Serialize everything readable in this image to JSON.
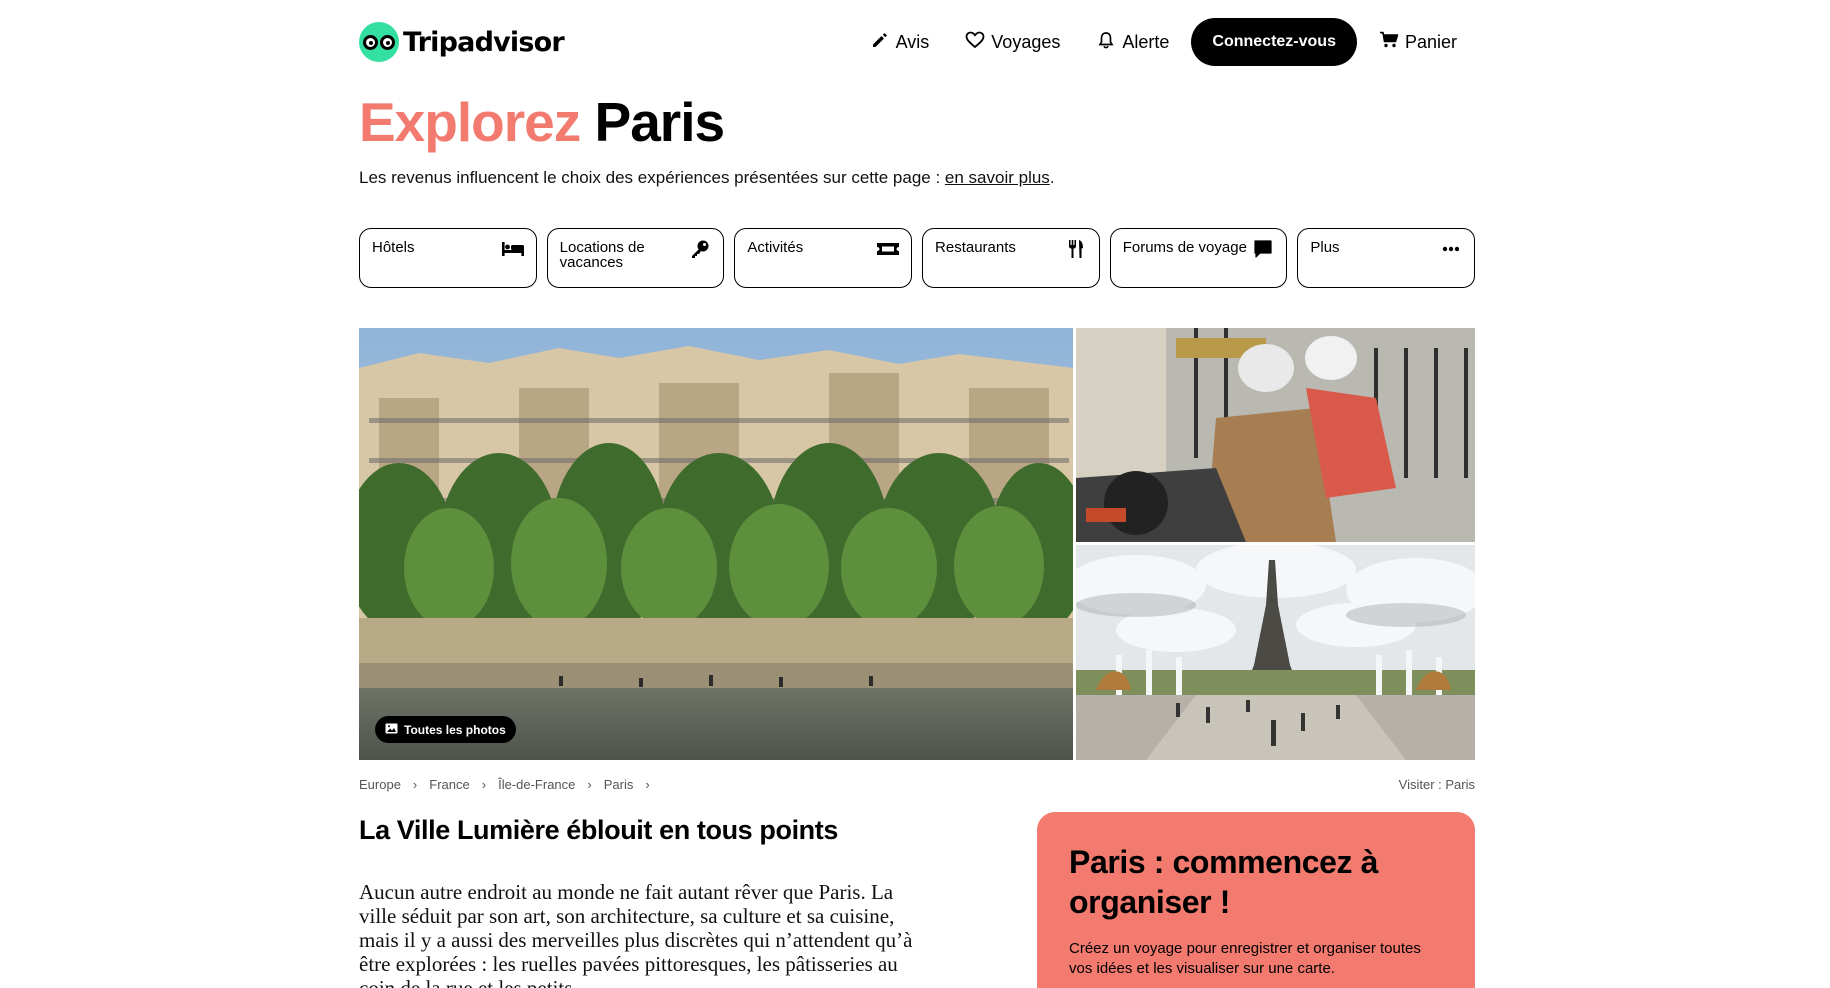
{
  "brand": {
    "name": "Tripadvisor",
    "color": "#34e0a1"
  },
  "nav": {
    "items": [
      {
        "label": "Avis",
        "icon": "pencil-icon"
      },
      {
        "label": "Voyages",
        "icon": "heart-icon"
      },
      {
        "label": "Alerte",
        "icon": "bell-icon"
      }
    ],
    "login_label": "Connectez-vous",
    "cart_label": "Panier"
  },
  "hero": {
    "title_accent": "Explorez",
    "title_place": "Paris",
    "accent_color": "#f27a6f",
    "disclaimer": "Les revenus influencent le choix des expériences présentées sur cette page : ",
    "disclaimer_link": "en savoir plus",
    "disclaimer_end": "."
  },
  "tiles": [
    {
      "label": "Hôtels",
      "icon": "bed-icon"
    },
    {
      "label": "Locations de vacances",
      "icon": "key-icon"
    },
    {
      "label": "Activités",
      "icon": "ticket-icon"
    },
    {
      "label": "Restaurants",
      "icon": "fork-knife-icon"
    },
    {
      "label": "Forums de voyage",
      "icon": "chat-bubble-icon"
    },
    {
      "label": "Plus",
      "icon": "more-icon"
    }
  ],
  "photos": {
    "all_photos_label": "Toutes les photos"
  },
  "breadcrumb": [
    "Europe",
    "France",
    "Île-de-France",
    "Paris"
  ],
  "visit_label": "Visiter : Paris",
  "content": {
    "heading": "La Ville Lumière éblouit en tous points",
    "paragraph": "Aucun autre endroit au monde ne fait autant rêver que Paris. La ville séduit par son art, son architecture, sa culture et sa cuisine, mais il y a aussi des merveilles plus discrètes qui n’attendent qu’à être explorées : les ruelles pavées pittoresques, les pâtisseries au coin de la rue et les petits"
  },
  "plan_card": {
    "title": "Paris : commencez à organiser !",
    "text": "Créez un voyage pour enregistrer et organiser toutes vos idées et les visualiser sur une carte."
  }
}
